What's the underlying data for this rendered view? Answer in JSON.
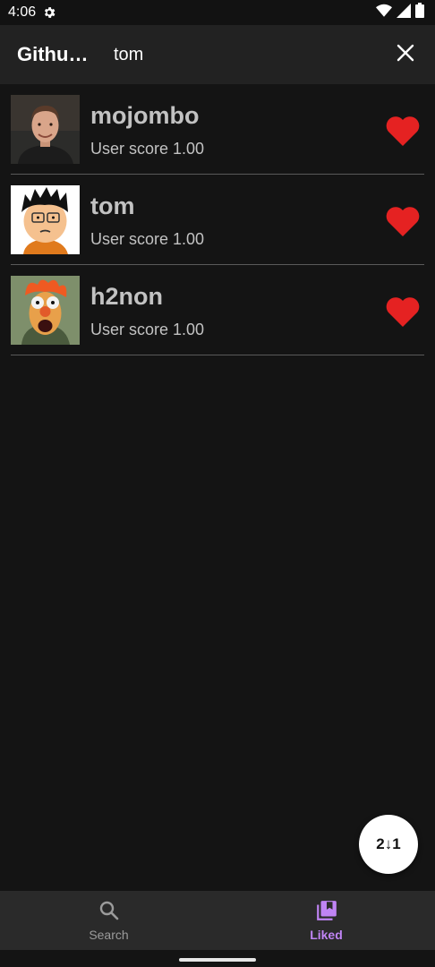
{
  "status_bar": {
    "time": "4:06",
    "icons": [
      "settings-gear-icon",
      "wifi-icon",
      "cell-signal-icon",
      "battery-icon"
    ]
  },
  "app_bar": {
    "title": "Github…",
    "search_value": "tom",
    "clear_icon": "close-icon"
  },
  "users": [
    {
      "name": "mojombo",
      "score_label": "User score",
      "score": "1.00",
      "liked": true
    },
    {
      "name": "tom",
      "score_label": "User score",
      "score": "1.00",
      "liked": true
    },
    {
      "name": "h2non",
      "score_label": "User score",
      "score": "1.00",
      "liked": true
    }
  ],
  "fab": {
    "icon": "sort-numeric-icon",
    "label": "2↓1"
  },
  "bottom_nav": {
    "items": [
      {
        "label": "Search",
        "icon": "search-icon",
        "active": false
      },
      {
        "label": "Liked",
        "icon": "library-bookmark-icon",
        "active": true
      }
    ]
  },
  "colors": {
    "background": "#141414",
    "app_bar": "#222222",
    "heart": "#e52222",
    "active_nav": "#c084f5",
    "inactive_nav": "#9b9b9b",
    "text_secondary": "#c2c2c2"
  }
}
